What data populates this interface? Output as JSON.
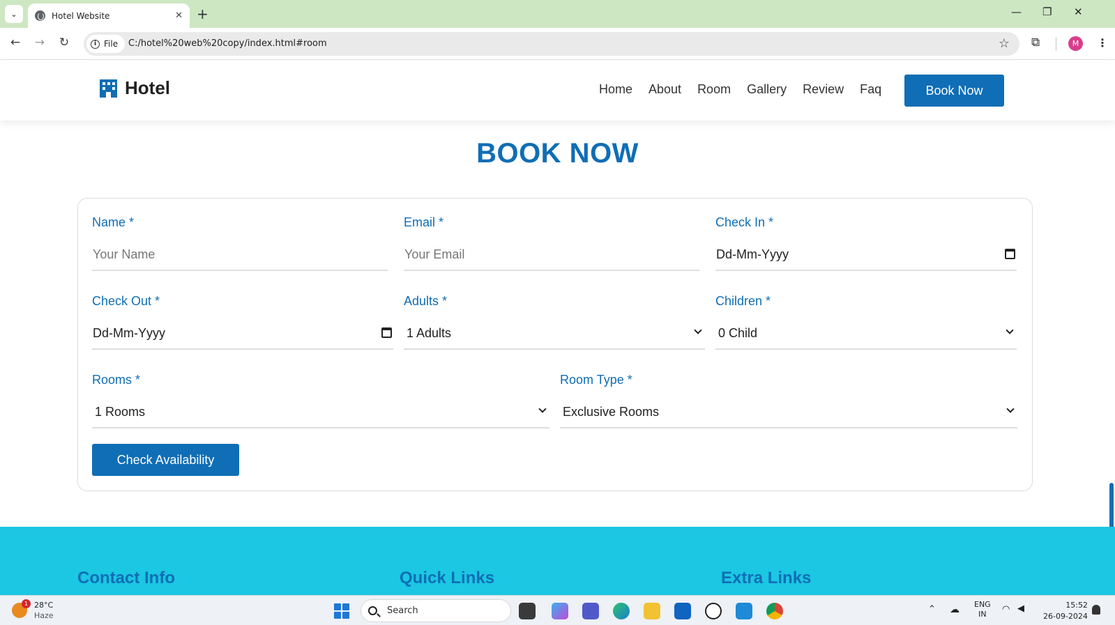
{
  "browser": {
    "tab_title": "Hotel Website",
    "file_chip_label": "File",
    "url": "C:/hotel%20web%20copy/index.html#room",
    "profile_initial": "M"
  },
  "site": {
    "logo_text": "Hotel",
    "nav": [
      "Home",
      "About",
      "Room",
      "Gallery",
      "Review",
      "Faq"
    ],
    "cta_label": "Book Now",
    "brand_color": "#0f6eb5"
  },
  "booking": {
    "title": "BOOK NOW",
    "name": {
      "label": "Name *",
      "placeholder": "Your Name"
    },
    "email": {
      "label": "Email *",
      "placeholder": "Your Email"
    },
    "check_in": {
      "label": "Check In *",
      "value": "Dd-Mm-Yyyy"
    },
    "check_out": {
      "label": "Check Out *",
      "value": "Dd-Mm-Yyyy"
    },
    "adults": {
      "label": "Adults *",
      "selected": "1 Adults"
    },
    "children": {
      "label": "Children *",
      "selected": "0 Child"
    },
    "rooms": {
      "label": "Rooms *",
      "selected": "1 Rooms"
    },
    "room_type": {
      "label": "Room Type *",
      "selected": "Exclusive Rooms"
    },
    "submit_label": "Check Availability"
  },
  "footer": {
    "headings": [
      "Contact Info",
      "Quick Links",
      "Extra Links"
    ],
    "bg_color": "#1bc7e3"
  },
  "taskbar": {
    "weather_temp": "28°C",
    "weather_desc": "Haze",
    "weather_badge": "1",
    "search_label": "Search",
    "lang_top": "ENG",
    "lang_bottom": "IN",
    "time": "15:52",
    "date": "26-09-2024"
  }
}
